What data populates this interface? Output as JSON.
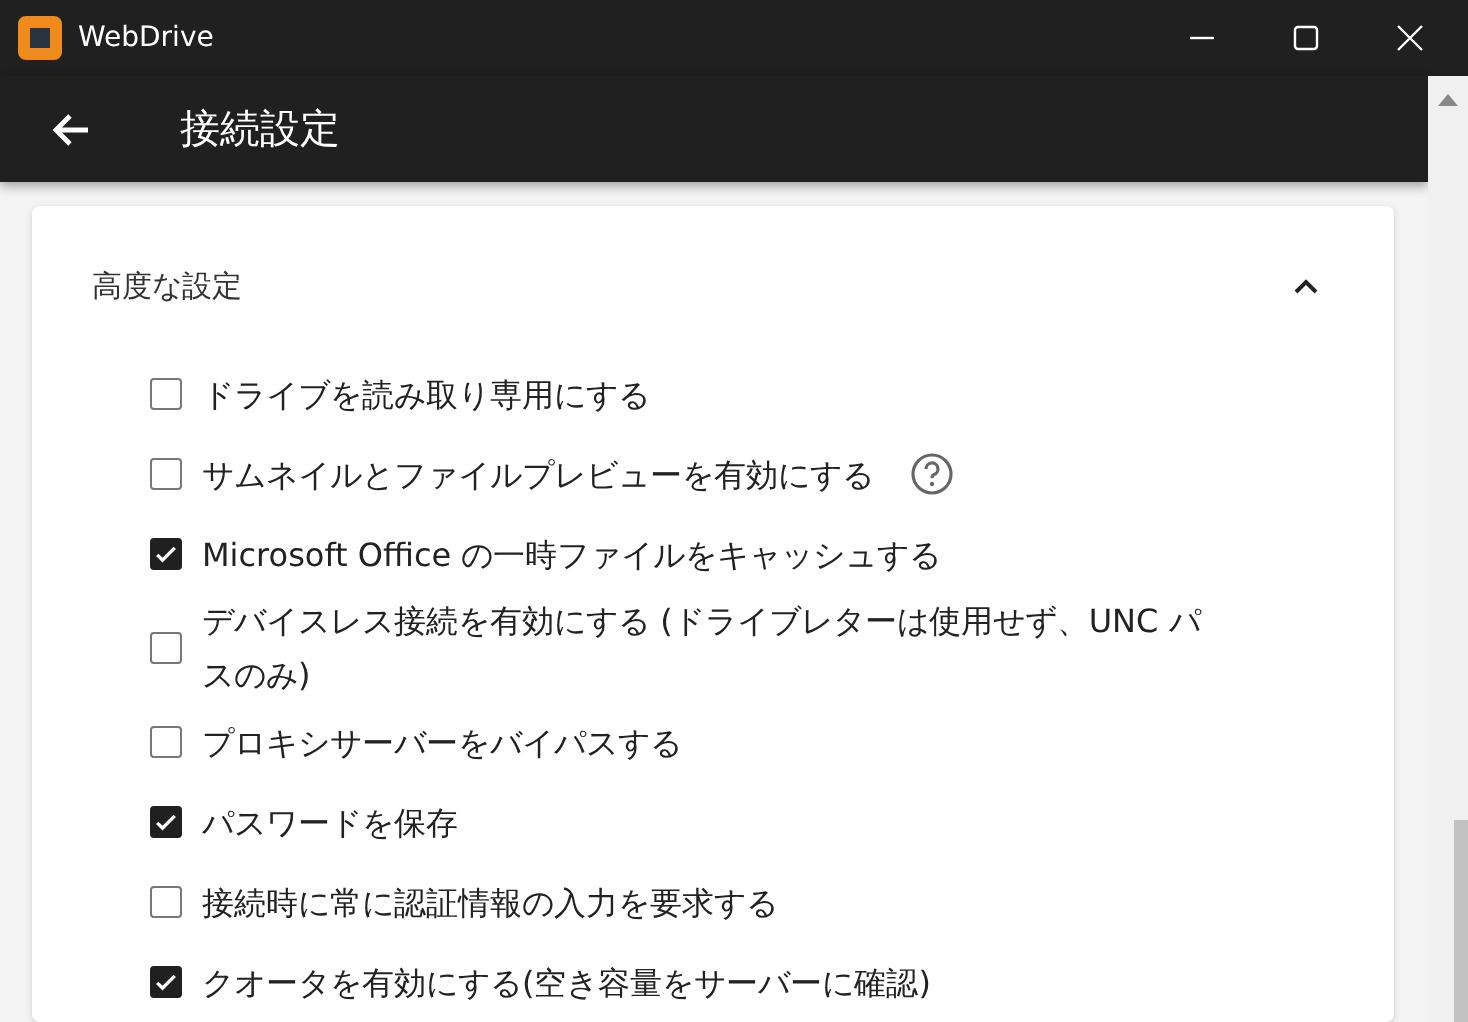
{
  "window": {
    "title": "WebDrive"
  },
  "header": {
    "title": "接続設定"
  },
  "section": {
    "title": "高度な設定",
    "expanded": true,
    "options": [
      {
        "label": "ドライブを読み取り専用にする",
        "checked": false,
        "help": false
      },
      {
        "label": "サムネイルとファイルプレビューを有効にする",
        "checked": false,
        "help": true
      },
      {
        "label": "Microsoft Office の一時ファイルをキャッシュする",
        "checked": true,
        "help": false
      },
      {
        "label": "デバイスレス接続を有効にする (ドライブレターは使用せず、UNC パスのみ)",
        "checked": false,
        "help": false
      },
      {
        "label": "プロキシサーバーをバイパスする",
        "checked": false,
        "help": false
      },
      {
        "label": "パスワードを保存",
        "checked": true,
        "help": false
      },
      {
        "label": "接続時に常に認証情報の入力を要求する",
        "checked": false,
        "help": false
      },
      {
        "label": "クオータを有効にする(空き容量をサーバーに確認)",
        "checked": true,
        "help": false
      }
    ]
  }
}
